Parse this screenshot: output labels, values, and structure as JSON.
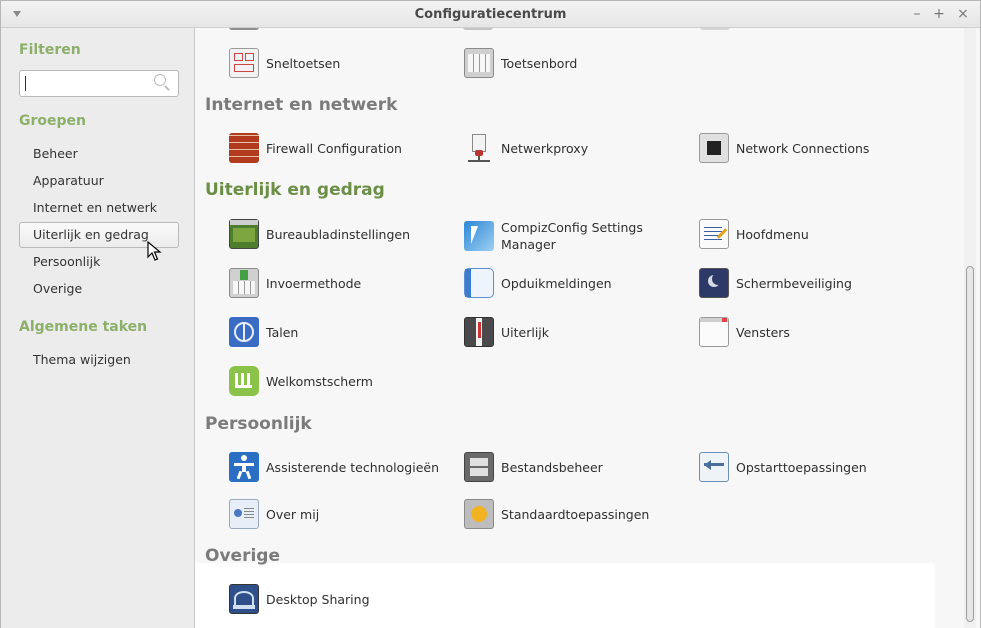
{
  "window": {
    "title": "Configuratiecentrum",
    "menu_icon": "chevron-down-icon",
    "buttons": [
      "–",
      "+",
      "×"
    ]
  },
  "sidebar": {
    "filter_heading": "Filteren",
    "search_value": "",
    "groups_heading": "Groepen",
    "groups": [
      "Beheer",
      "Apparatuur",
      "Internet en netwerk",
      "Uiterlijk en gedrag",
      "Persoonlijk",
      "Overige"
    ],
    "active_group": "Uiterlijk en gedrag",
    "tasks_heading": "Algemene taken",
    "tasks": [
      "Thema wijzigen"
    ]
  },
  "main": {
    "top_items": [
      {
        "label": "Sneltoetsen",
        "icon": "keyboard-shortcuts-icon"
      },
      {
        "label": "Toetsenbord",
        "icon": "keyboard-icon"
      }
    ],
    "sections": [
      {
        "heading": "Internet en netwerk",
        "items": [
          {
            "label": "Firewall Configuration",
            "icon": "firewall-icon"
          },
          {
            "label": "Netwerkproxy",
            "icon": "network-proxy-icon"
          },
          {
            "label": "Network Connections",
            "icon": "network-connections-icon"
          }
        ]
      },
      {
        "heading": "Uiterlijk en gedrag",
        "items": [
          {
            "label": "Bureaubladinstellingen",
            "icon": "desktop-settings-icon"
          },
          {
            "label": "CompizConfig Settings Manager",
            "icon": "compiz-icon"
          },
          {
            "label": "Hoofdmenu",
            "icon": "main-menu-icon"
          },
          {
            "label": "Invoermethode",
            "icon": "input-method-icon"
          },
          {
            "label": "Opduikmeldingen",
            "icon": "notifications-icon"
          },
          {
            "label": "Schermbeveiliging",
            "icon": "screensaver-icon"
          },
          {
            "label": "Talen",
            "icon": "languages-icon"
          },
          {
            "label": "Uiterlijk",
            "icon": "appearance-icon"
          },
          {
            "label": "Vensters",
            "icon": "windows-icon"
          },
          {
            "label": "Welkomstscherm",
            "icon": "welcome-screen-icon"
          }
        ]
      },
      {
        "heading": "Persoonlijk",
        "items": [
          {
            "label": "Assisterende technologieën",
            "icon": "accessibility-icon"
          },
          {
            "label": "Bestandsbeheer",
            "icon": "file-manager-icon"
          },
          {
            "label": "Opstarttoepassingen",
            "icon": "startup-apps-icon"
          },
          {
            "label": "Over mij",
            "icon": "about-me-icon"
          },
          {
            "label": "Standaardtoepassingen",
            "icon": "default-apps-icon"
          }
        ]
      },
      {
        "heading": "Overige",
        "items": [
          {
            "label": "Desktop Sharing",
            "icon": "desktop-sharing-icon"
          }
        ]
      }
    ]
  }
}
